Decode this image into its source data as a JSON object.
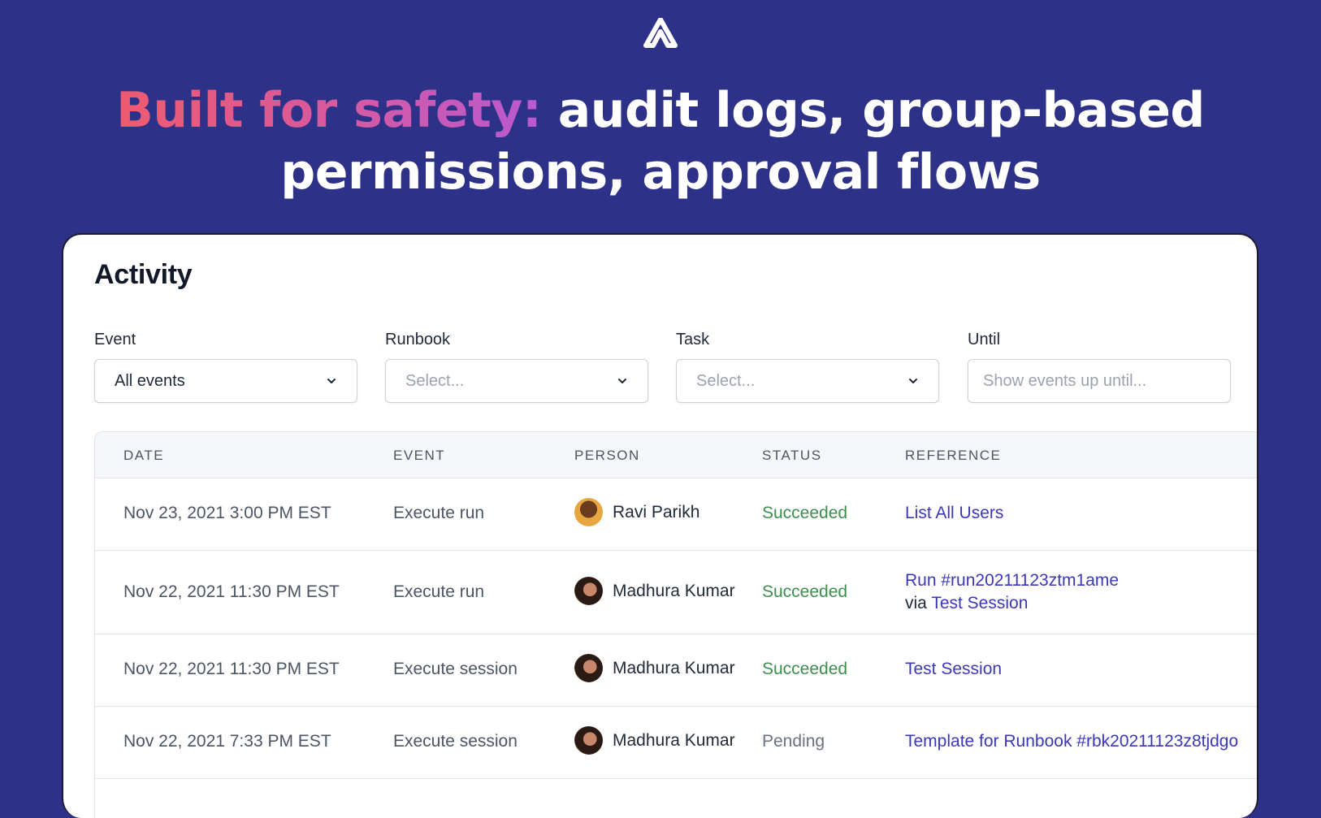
{
  "hero": {
    "headline_highlight": "Built for safety:",
    "headline_rest_line1": " audit logs, group-based",
    "headline_line2": "permissions, approval flows"
  },
  "colors": {
    "background": "#2d3187",
    "highlight_gradient": [
      "#ee5b6f",
      "#b85ad0"
    ],
    "status_succeeded": "#3e8e4f",
    "link": "#3b38b8"
  },
  "card": {
    "title": "Activity",
    "filters": [
      {
        "label": "Event",
        "value": "All events",
        "icon": "chevron-down-icon"
      },
      {
        "label": "Runbook",
        "placeholder": "Select...",
        "icon": "chevron-down-icon"
      },
      {
        "label": "Task",
        "placeholder": "Select...",
        "icon": "chevron-down-icon"
      },
      {
        "label": "Until",
        "placeholder": "Show events up until..."
      }
    ],
    "table": {
      "headers": [
        "DATE",
        "EVENT",
        "PERSON",
        "STATUS",
        "REFERENCE"
      ],
      "rows": [
        {
          "date": "Nov 23, 2021 3:00 PM EST",
          "event": "Execute run",
          "person": "Ravi Parikh",
          "status": "Succeeded",
          "reference": "List All Users"
        },
        {
          "date": "Nov 22, 2021 11:30 PM EST",
          "event": "Execute run",
          "person": "Madhura Kumar",
          "status": "Succeeded",
          "reference": "Run #run20211123ztm1ame",
          "via_label": "via",
          "via_link": "Test Session"
        },
        {
          "date": "Nov 22, 2021 11:30 PM EST",
          "event": "Execute session",
          "person": "Madhura Kumar",
          "status": "Succeeded",
          "reference": "Test Session"
        },
        {
          "date": "Nov 22, 2021 7:33 PM EST",
          "event": "Execute session",
          "person": "Madhura Kumar",
          "status": "Pending",
          "reference": "Template for Runbook #rbk20211123z8tjdgo"
        }
      ]
    }
  }
}
